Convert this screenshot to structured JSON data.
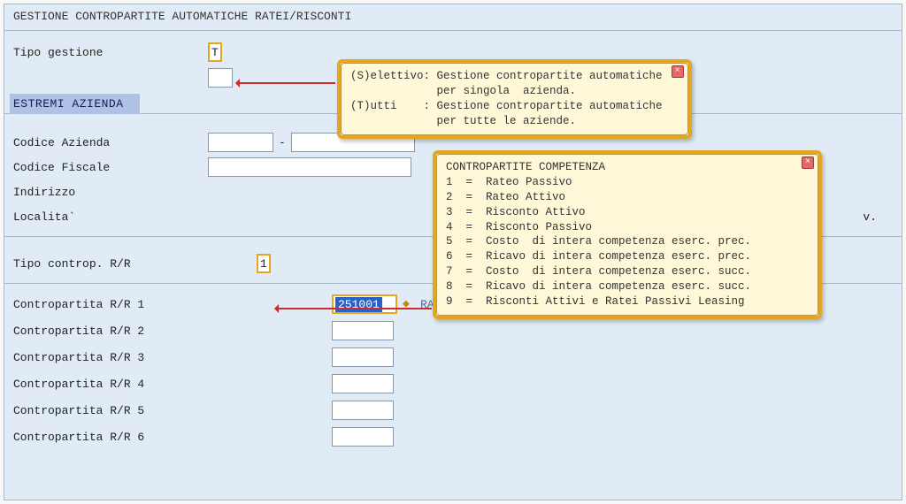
{
  "window_title": "GESTIONE CONTROPARTITE AUTOMATICHE RATEI/RISCONTI",
  "tipo_gestione": {
    "label": "Tipo gestione",
    "value": "T"
  },
  "help_tipo_gestione": {
    "line1": "(S)elettivo: Gestione contropartite automatiche",
    "line2": "             per singola  azienda.",
    "line3": "(T)utti    : Gestione contropartite automatiche",
    "line4": "             per tutte le aziende."
  },
  "estremi": {
    "heading": "ESTREMI AZIENDA",
    "codice_azienda_label": "Codice Azienda",
    "codice_fiscale_label": "Codice Fiscale",
    "indirizzo_label": "Indirizzo",
    "localita_label": "Localita`",
    "localita_suffix": "v."
  },
  "tipo_controp": {
    "label": "Tipo controp. R/R",
    "value": "1"
  },
  "help_controp": {
    "title": "CONTROPARTITE COMPETENZA",
    "rows": [
      "1  =  Rateo Passivo",
      "2  =  Rateo Attivo",
      "3  =  Risconto Attivo",
      "4  =  Risconto Passivo",
      "5  =  Costo  di intera competenza eserc. prec.",
      "6  =  Ricavo di intera competenza eserc. prec.",
      "7  =  Costo  di intera competenza eserc. succ.",
      "8  =  Ricavo di intera competenza eserc. succ.",
      "9  =  Risconti Attivi e Ratei Passivi Leasing"
    ]
  },
  "contropartite": {
    "active_value": "251001",
    "active_desc": "RATEI PASSIVI",
    "labels": [
      "Contropartita R/R 1",
      "Contropartita R/R 2",
      "Contropartita R/R 3",
      "Contropartita R/R 4",
      "Contropartita R/R 5",
      "Contropartita R/R 6"
    ]
  }
}
